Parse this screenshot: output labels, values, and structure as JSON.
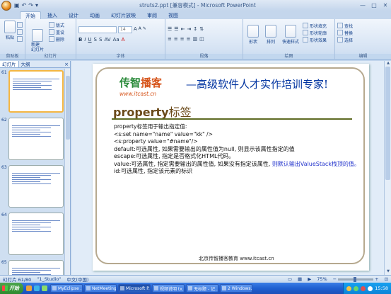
{
  "window": {
    "title": "struts2.ppt [兼容模式] - Microsoft PowerPoint",
    "min": "—",
    "max": "□",
    "close": "✕"
  },
  "ribbon": {
    "tabs": [
      "开始",
      "插入",
      "设计",
      "动画",
      "幻灯片放映",
      "审阅",
      "视图"
    ],
    "active_tab": "开始",
    "groups": {
      "clipboard": {
        "label": "剪贴板",
        "paste": "粘贴"
      },
      "slides": {
        "label": "幻灯片",
        "new_slide": "新建\n幻灯片",
        "layout": "版式",
        "reset": "重设",
        "delete": "删除"
      },
      "font": {
        "label": "字体",
        "size": "14",
        "bold": "B",
        "italic": "I",
        "underline": "U",
        "strike": "S"
      },
      "paragraph": {
        "label": "段落"
      },
      "drawing": {
        "label": "绘图",
        "shapes": "形状",
        "arrange": "排列",
        "quick_styles": "快速样式",
        "fill": "形状填充",
        "outline": "形状轮廓",
        "effects": "形状效果"
      },
      "editing": {
        "label": "编辑",
        "find": "查找",
        "replace": "替换",
        "select": "选择"
      }
    }
  },
  "left_panel": {
    "tabs": [
      "幻灯片",
      "大纲"
    ],
    "close": "×",
    "slides": [
      {
        "num": "61",
        "selected": true
      },
      {
        "num": "62",
        "selected": false
      },
      {
        "num": "63",
        "selected": false
      },
      {
        "num": "64",
        "selected": false
      },
      {
        "num": "65",
        "selected": false
      }
    ]
  },
  "slide": {
    "logo_cz": "传智",
    "logo_bk": "播客",
    "logo_url": "www.itcast.cn",
    "slogan": "—高级软件人才实作培训专家!",
    "title_en": "property",
    "title_cn": "标签",
    "lines": [
      "property标签用于输出指定值:",
      "<s:set name=\"name\" value=\"kk\" />",
      "<s:property value=\"#name\"/>",
      "default:可选属性, 如果需要输出的属性值为null, 则显示该属性指定的值",
      "escape:可选属性, 指定是否格式化HTML代码。",
      "value:可选属性, 指定需要输出的属性值, 如果没有指定该属性, ",
      "则默认输出ValueStack栈顶的值。",
      "id:可选属性, 指定该元素的标识"
    ],
    "footer": "北京传智播客教育 www.itcast.cn"
  },
  "statusbar": {
    "slide_info": "幻灯片 61/80",
    "theme": "\"1_Studio\"",
    "language": "中文(中国)",
    "zoom": "75%"
  },
  "taskbar": {
    "start": "开始",
    "tasks": [
      "MyEclipse ...",
      "NetMeeting...",
      "Microsoft P...",
      "视频说明 tx...",
      "无标题 - 记...",
      "2 Windows..."
    ],
    "active_task": 2,
    "clock": "15:58"
  },
  "colors": {
    "accent": "#15428b",
    "title_brown": "#6b4a1a",
    "slogan_blue": "#0033a0",
    "logo_green": "#2a8a3a",
    "logo_orange": "#d6541a"
  }
}
